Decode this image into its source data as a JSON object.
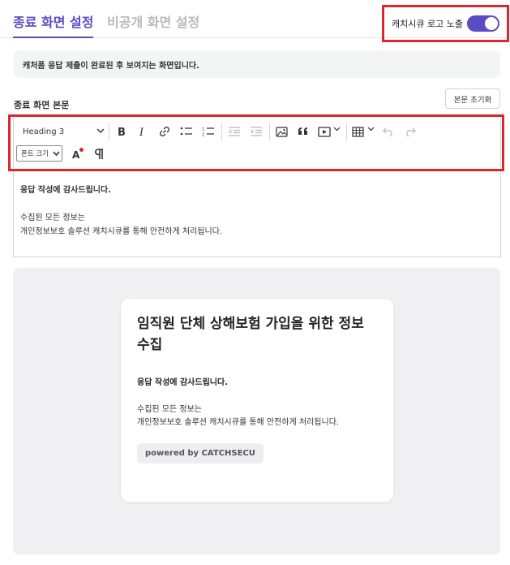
{
  "tabs": [
    {
      "label": "종료 화면 설정",
      "active": true
    },
    {
      "label": "비공개 화면 설정",
      "active": false
    }
  ],
  "logo_toggle": {
    "label": "캐치시큐 로고 노출",
    "on": true
  },
  "info_banner": "캐처폼 응답 제출이 완료된 후 보여지는 화면입니다.",
  "section_label": "종료 화면 본문",
  "reset_button": "본문 초기화",
  "toolbar": {
    "heading_select": "Heading 3",
    "font_size_select": "폰트 크기"
  },
  "editor": {
    "bold_line": "응답 작성에 감사드립니다.",
    "line1": "수집된 모든 정보는",
    "line2": "개인정보보호 솔루션 캐치시큐를 통해 안전하게 처리됩니다."
  },
  "preview": {
    "title": "임직원 단체 상해보험 가입을 위한 정보 수집",
    "bold_line": "응답 작성에 감사드립니다.",
    "line1": "수집된 모든 정보는",
    "line2": "개인정보보호 솔루션 캐치시큐를 통해 안전하게 처리됩니다.",
    "powered": "powered by CATCHSECU"
  },
  "colors": {
    "accent": "#5b4bc4",
    "highlight": "#d9282f",
    "preview_bg": "#f0f0f2"
  }
}
